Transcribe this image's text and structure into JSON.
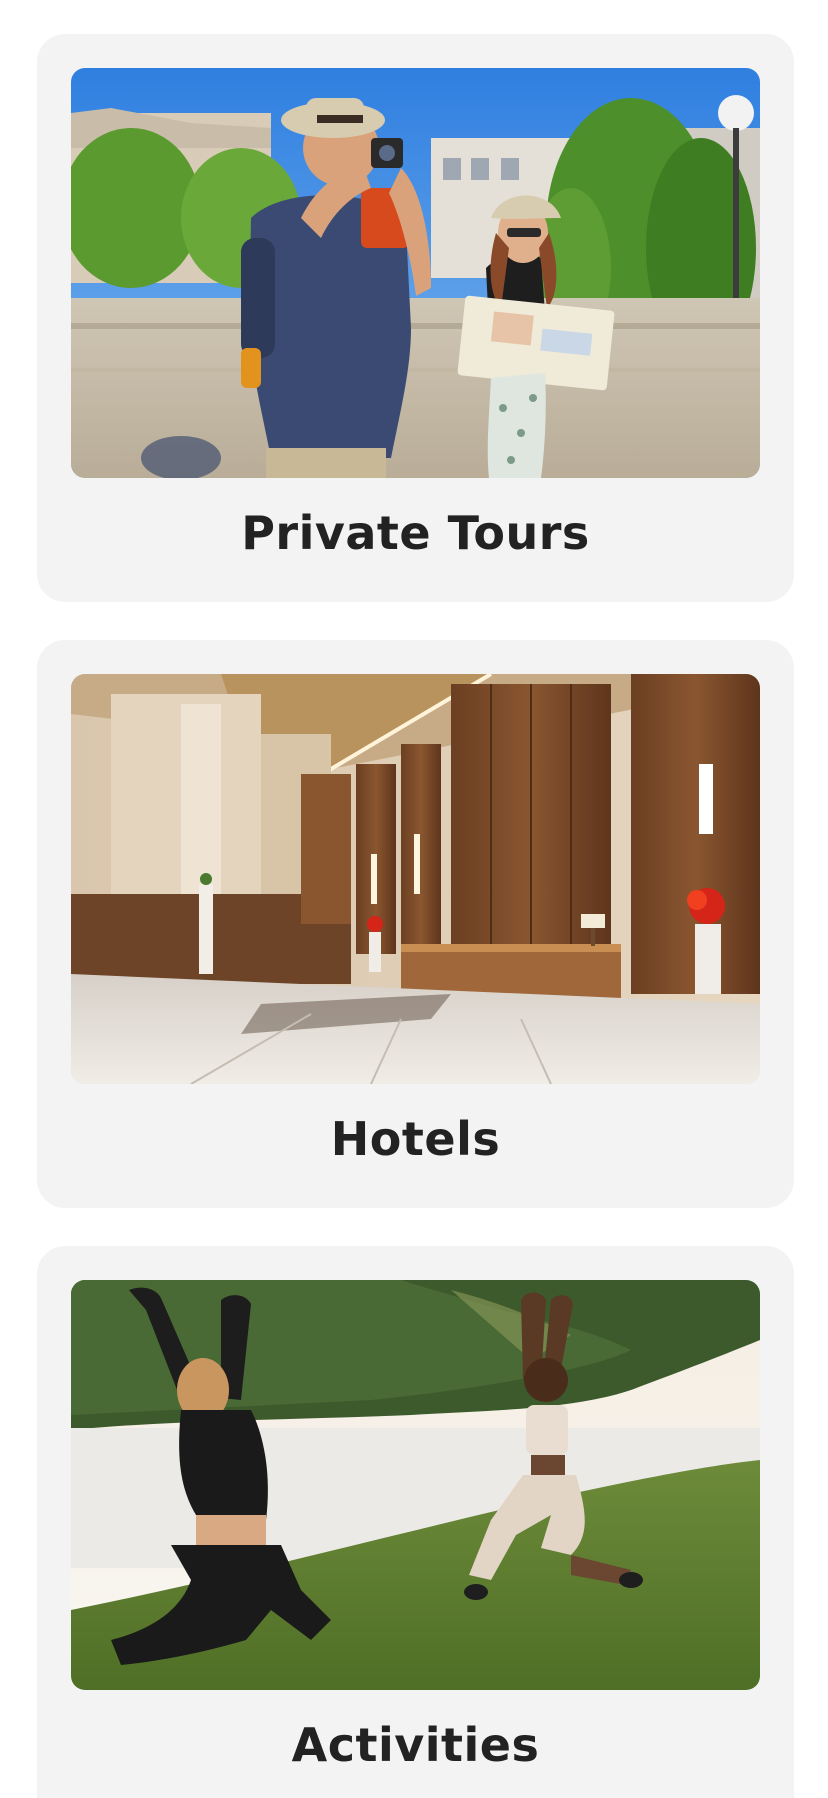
{
  "categories": [
    {
      "label": "Private Tours",
      "image": "tourists-with-camera-and-map-photo"
    },
    {
      "label": "Hotels",
      "image": "hotel-lobby-photo"
    },
    {
      "label": "Activities",
      "image": "outdoor-yoga-by-lake-photo"
    }
  ],
  "colors": {
    "card_background": "#f3f3f3",
    "label_text": "#222222",
    "page_background": "#ffffff"
  }
}
